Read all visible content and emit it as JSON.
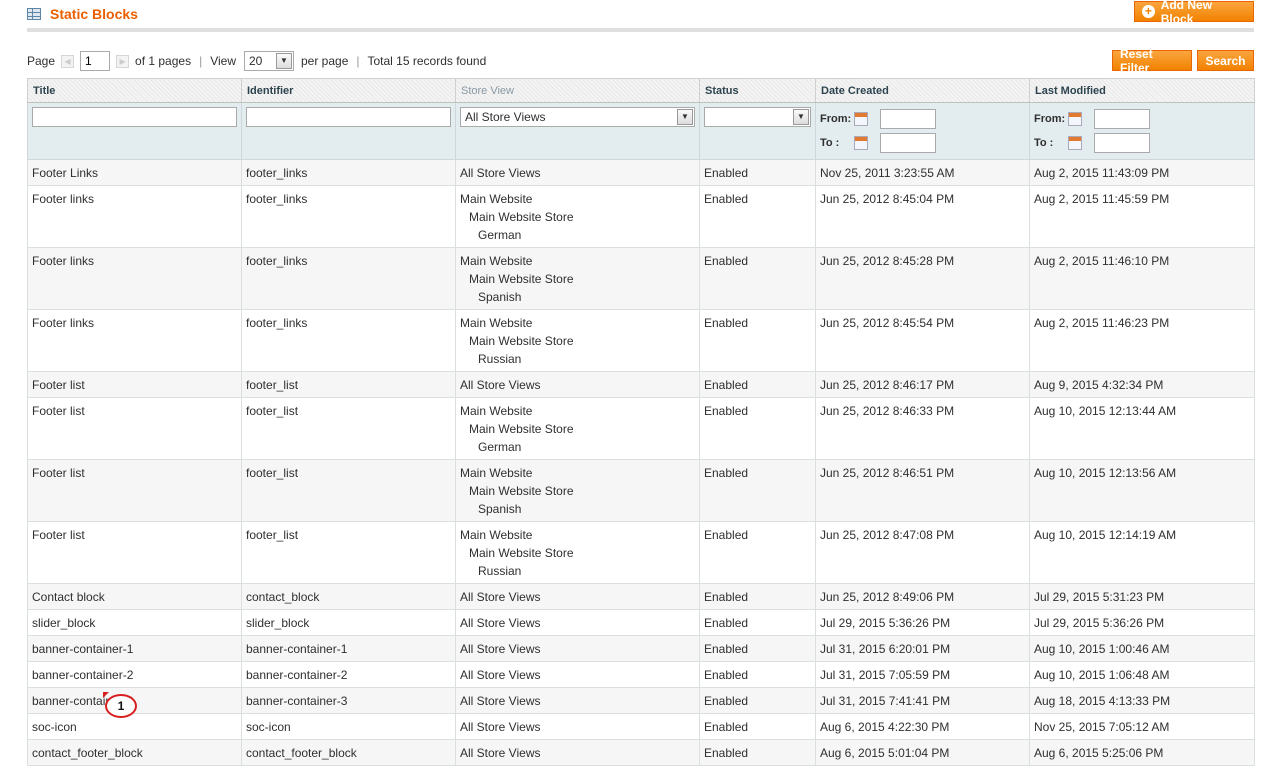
{
  "header": {
    "title": "Static Blocks",
    "add_button": "Add New Block",
    "title_icon": "grid-icon"
  },
  "pager": {
    "page_label": "Page",
    "page_value": "1",
    "of_pages": "of 1 pages",
    "view_label": "View",
    "per_page_value": "20",
    "per_page_label": "per page",
    "total": "Total 15 records found"
  },
  "actions": {
    "reset": "Reset Filter",
    "search": "Search"
  },
  "columns": {
    "title": "Title",
    "identifier": "Identifier",
    "store_view": "Store View",
    "status": "Status",
    "date_created": "Date Created",
    "last_modified": "Last Modified"
  },
  "filters": {
    "store_view_value": "All Store Views",
    "from_label": "From:",
    "to_label": "To :"
  },
  "rows": [
    {
      "title": "Footer Links",
      "identifier": "footer_links",
      "store": [
        "All Store Views"
      ],
      "status": "Enabled",
      "created": "Nov 25, 2011 3:23:55 AM",
      "modified": "Aug 2, 2015 11:43:09 PM"
    },
    {
      "title": "Footer links",
      "identifier": "footer_links",
      "store": [
        "Main Website",
        "Main Website Store",
        "German"
      ],
      "status": "Enabled",
      "created": "Jun 25, 2012 8:45:04 PM",
      "modified": "Aug 2, 2015 11:45:59 PM"
    },
    {
      "title": "Footer links",
      "identifier": "footer_links",
      "store": [
        "Main Website",
        "Main Website Store",
        "Spanish"
      ],
      "status": "Enabled",
      "created": "Jun 25, 2012 8:45:28 PM",
      "modified": "Aug 2, 2015 11:46:10 PM"
    },
    {
      "title": "Footer links",
      "identifier": "footer_links",
      "store": [
        "Main Website",
        "Main Website Store",
        "Russian"
      ],
      "status": "Enabled",
      "created": "Jun 25, 2012 8:45:54 PM",
      "modified": "Aug 2, 2015 11:46:23 PM"
    },
    {
      "title": "Footer list",
      "identifier": "footer_list",
      "store": [
        "All Store Views"
      ],
      "status": "Enabled",
      "created": "Jun 25, 2012 8:46:17 PM",
      "modified": "Aug 9, 2015 4:32:34 PM"
    },
    {
      "title": "Footer list",
      "identifier": "footer_list",
      "store": [
        "Main Website",
        "Main Website Store",
        "German"
      ],
      "status": "Enabled",
      "created": "Jun 25, 2012 8:46:33 PM",
      "modified": "Aug 10, 2015 12:13:44 AM"
    },
    {
      "title": "Footer list",
      "identifier": "footer_list",
      "store": [
        "Main Website",
        "Main Website Store",
        "Spanish"
      ],
      "status": "Enabled",
      "created": "Jun 25, 2012 8:46:51 PM",
      "modified": "Aug 10, 2015 12:13:56 AM"
    },
    {
      "title": "Footer list",
      "identifier": "footer_list",
      "store": [
        "Main Website",
        "Main Website Store",
        "Russian"
      ],
      "status": "Enabled",
      "created": "Jun 25, 2012 8:47:08 PM",
      "modified": "Aug 10, 2015 12:14:19 AM"
    },
    {
      "title": "Contact block",
      "identifier": "contact_block",
      "store": [
        "All Store Views"
      ],
      "status": "Enabled",
      "created": "Jun 25, 2012 8:49:06 PM",
      "modified": "Jul 29, 2015 5:31:23 PM"
    },
    {
      "title": "slider_block",
      "identifier": "slider_block",
      "store": [
        "All Store Views"
      ],
      "status": "Enabled",
      "created": "Jul 29, 2015 5:36:26 PM",
      "modified": "Jul 29, 2015 5:36:26 PM"
    },
    {
      "title": "banner-container-1",
      "identifier": "banner-container-1",
      "store": [
        "All Store Views"
      ],
      "status": "Enabled",
      "created": "Jul 31, 2015 6:20:01 PM",
      "modified": "Aug 10, 2015 1:00:46 AM"
    },
    {
      "title": "banner-container-2",
      "identifier": "banner-container-2",
      "store": [
        "All Store Views"
      ],
      "status": "Enabled",
      "created": "Jul 31, 2015 7:05:59 PM",
      "modified": "Aug 10, 2015 1:06:48 AM"
    },
    {
      "title": "banner-container-3",
      "identifier": "banner-container-3",
      "store": [
        "All Store Views"
      ],
      "status": "Enabled",
      "created": "Jul 31, 2015 7:41:41 PM",
      "modified": "Aug 18, 2015 4:13:33 PM"
    },
    {
      "title": "soc-icon",
      "identifier": "soc-icon",
      "store": [
        "All Store Views"
      ],
      "status": "Enabled",
      "created": "Aug 6, 2015 4:22:30 PM",
      "modified": "Nov 25, 2015 7:05:12 AM"
    },
    {
      "title": "contact_footer_block",
      "identifier": "contact_footer_block",
      "store": [
        "All Store Views"
      ],
      "status": "Enabled",
      "created": "Aug 6, 2015 5:01:04 PM",
      "modified": "Aug 6, 2015 5:25:06 PM"
    }
  ],
  "annotation": {
    "marker": "1"
  },
  "colors": {
    "accent": "#eb5e00",
    "button": "#f18200",
    "filter_bg": "#e3ecef"
  }
}
